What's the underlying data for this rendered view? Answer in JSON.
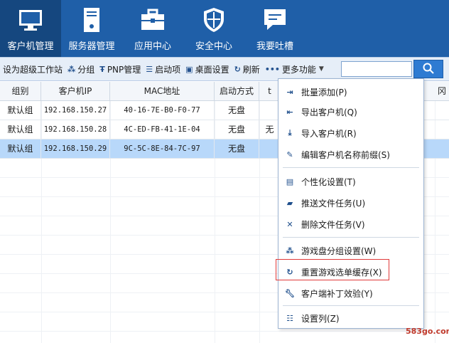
{
  "nav": {
    "items": [
      {
        "label": "客户机管理",
        "icon": "monitor-icon",
        "active": true
      },
      {
        "label": "服务器管理",
        "icon": "server-icon",
        "active": false
      },
      {
        "label": "应用中心",
        "icon": "toolbox-icon",
        "active": false
      },
      {
        "label": "安全中心",
        "icon": "shield-icon",
        "active": false
      },
      {
        "label": "我要吐槽",
        "icon": "chat-icon",
        "active": false
      }
    ]
  },
  "toolbar": {
    "set_super": "设为超级工作站",
    "group": "分组",
    "pnp": "PNP管理",
    "boot": "启动项",
    "desktop": "桌面设置",
    "refresh": "刷新",
    "more": "更多功能",
    "search_value": ""
  },
  "table": {
    "headers": [
      "组别",
      "客户机IP",
      "MAC地址",
      "启动方式",
      "t",
      "冈"
    ],
    "rows": [
      [
        "默认组",
        "192.168.150.27",
        "40-16-7E-B0-F0-77",
        "无盘",
        ""
      ],
      [
        "默认组",
        "192.168.150.28",
        "4C-ED-FB-41-1E-04",
        "无盘",
        "无"
      ],
      [
        "默认组",
        "192.168.150.29",
        "9C-5C-8E-84-7C-97",
        "无盘",
        ""
      ]
    ],
    "selected_row": 2
  },
  "menu": {
    "items": [
      {
        "label": "批量添加(P)",
        "icon": "batch-add-icon"
      },
      {
        "label": "导出客户机(Q)",
        "icon": "export-icon"
      },
      {
        "label": "导入客户机(R)",
        "icon": "import-icon"
      },
      {
        "label": "编辑客户机名称前缀(S)",
        "icon": "edit-icon"
      },
      {
        "label": "个性化设置(T)",
        "icon": "personalize-icon"
      },
      {
        "label": "推送文件任务(U)",
        "icon": "folder-icon"
      },
      {
        "label": "删除文件任务(V)",
        "icon": "delete-icon"
      },
      {
        "label": "游戏盘分组设置(W)",
        "icon": "group-dots-icon"
      },
      {
        "label": "重置游戏选单缓存(X)",
        "icon": "reset-icon"
      },
      {
        "label": "客户端补丁效验(Y)",
        "icon": "wrench-icon"
      },
      {
        "label": "设置列(Z)",
        "icon": "columns-icon"
      }
    ]
  },
  "watermark": "583go.com"
}
